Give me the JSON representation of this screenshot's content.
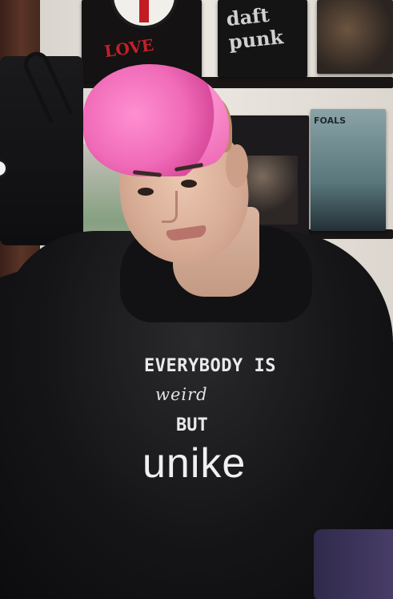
{
  "photo": {
    "hoodie_print": {
      "line1": "EVERYBODY IS",
      "line2": "weird",
      "line3": "BUT",
      "line4": "unike"
    },
    "record_labels": {
      "record_1_text": "LOVE",
      "record_2_text": "daft punk",
      "record_5_text": "FOALS"
    },
    "colors": {
      "hair": "#f06bb8",
      "hoodie": "#151517",
      "print": "#ececec"
    }
  }
}
